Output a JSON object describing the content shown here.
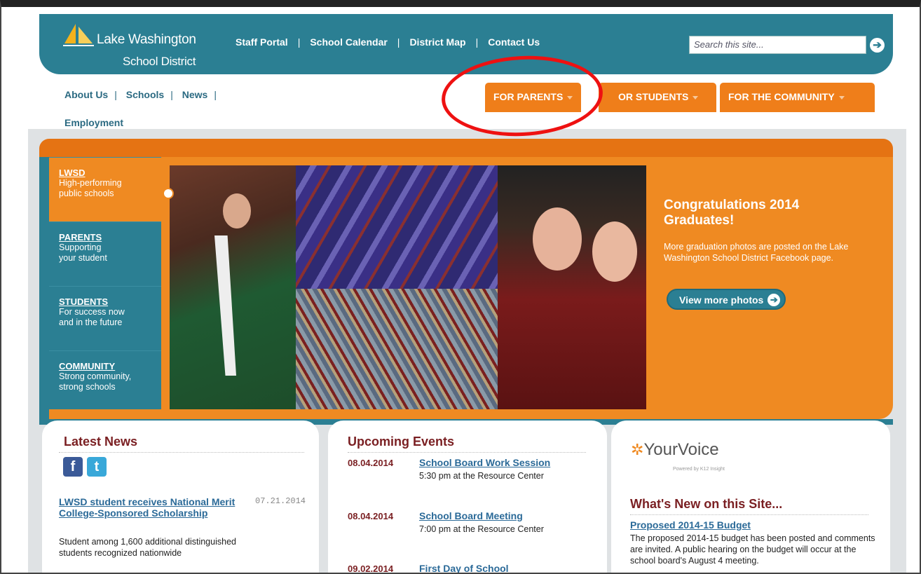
{
  "logo": {
    "line1": "Lake Washington",
    "line2": "School District"
  },
  "topnav": [
    "Staff Portal",
    "School Calendar",
    "District Map",
    "Contact Us"
  ],
  "search": {
    "placeholder": "Search this site..."
  },
  "secnav": {
    "items": [
      "About Us",
      "Schools",
      "News"
    ],
    "second_line": "Employment"
  },
  "tabs": [
    "FOR PARENTS",
    "OR STUDENTS",
    "FOR THE COMMUNITY"
  ],
  "sidebar": [
    {
      "heading": "LWSD",
      "text1": "High-performing",
      "text2": "public schools"
    },
    {
      "heading": "PARENTS",
      "text1": "Supporting",
      "text2": "your student"
    },
    {
      "heading": "STUDENTS",
      "text1": "For success now",
      "text2": "and in the future"
    },
    {
      "heading": "COMMUNITY",
      "text1": "Strong community,",
      "text2": "strong schools"
    }
  ],
  "hero": {
    "title1": "Congratulations 2014",
    "title2": "Graduates!",
    "text": "More graduation photos are posted on the Lake Washington School District Facebook page.",
    "button": "View more photos"
  },
  "news": {
    "title": "Latest News",
    "link": "LWSD student receives National Merit College-Sponsored Scholarship",
    "date": "07.21.2014",
    "text": "Student among 1,600 additional distinguished students recognized nationwide"
  },
  "events": {
    "title": "Upcoming Events",
    "items": [
      {
        "date": "08.04.2014",
        "title": "School Board Work Session",
        "sub": "5:30 pm at the Resource Center"
      },
      {
        "date": "08.04.2014",
        "title": "School Board Meeting",
        "sub": "7:00 pm at the Resource Center"
      },
      {
        "date": "09.02.2014",
        "title": "First Day of School",
        "sub": ""
      }
    ]
  },
  "yourvoice": {
    "logo": "YourVoice",
    "sub": "Powered by K12 Insight"
  },
  "whatsnew": {
    "title": "What's New on this Site...",
    "link": "Proposed 2014-15 Budget",
    "text": "The proposed 2014-15 budget has been posted and comments are invited. A public hearing on the budget will occur at the school board's August 4 meeting."
  },
  "colors": {
    "teal": "#2b7f93",
    "orange": "#ef8a22",
    "maroon": "#7a1f22",
    "highlight_oval": "#e11111"
  }
}
